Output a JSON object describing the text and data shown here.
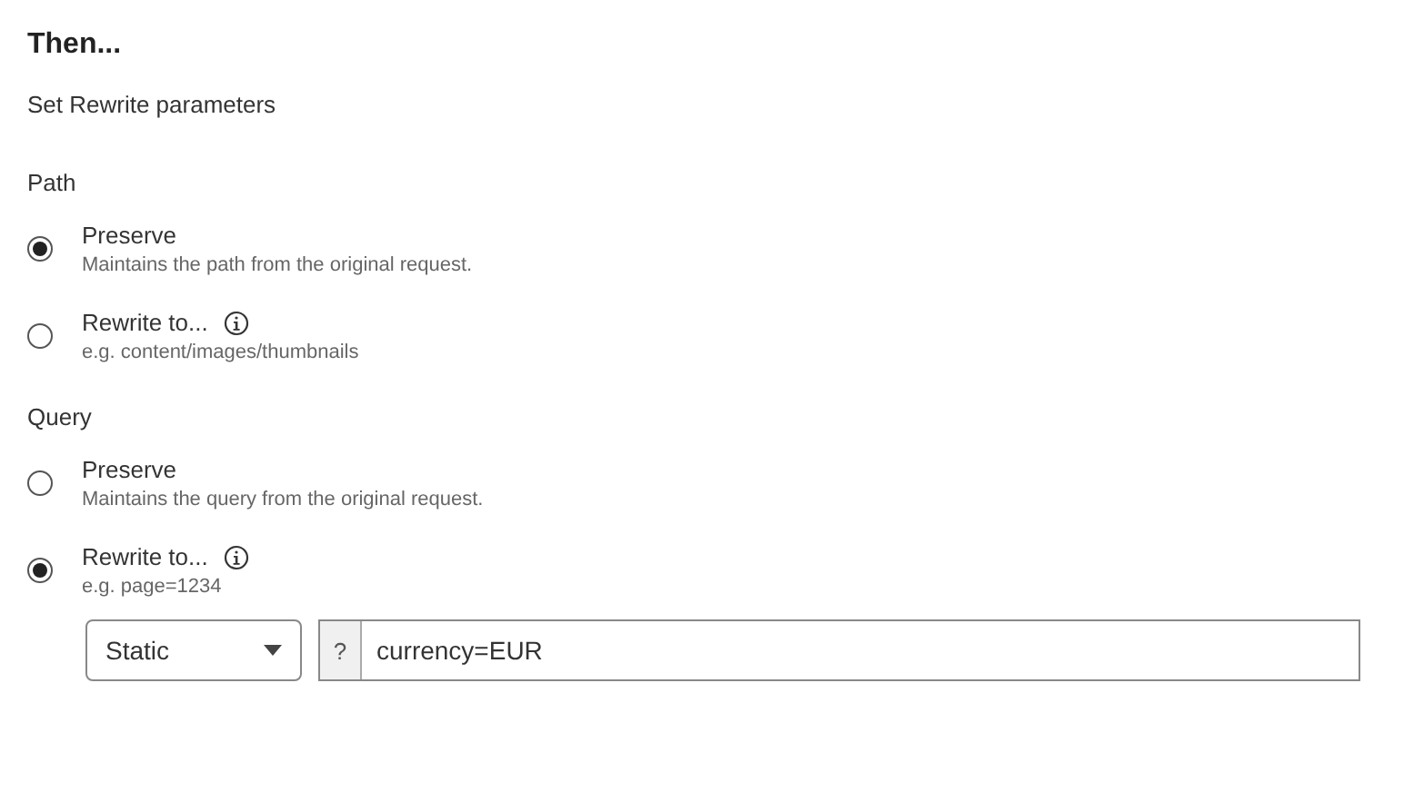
{
  "heading": "Then...",
  "subtitle": "Set Rewrite parameters",
  "groups": [
    {
      "label": "Path",
      "options": [
        {
          "label": "Preserve",
          "description": "Maintains the path from the original request.",
          "selected": true,
          "info": false
        },
        {
          "label": "Rewrite to...",
          "description": "e.g. content/images/thumbnails",
          "selected": false,
          "info": true
        }
      ]
    },
    {
      "label": "Query",
      "options": [
        {
          "label": "Preserve",
          "description": "Maintains the query from the original request.",
          "selected": false,
          "info": false
        },
        {
          "label": "Rewrite to...",
          "description": "e.g. page=1234",
          "selected": true,
          "info": true
        }
      ],
      "controls": {
        "select": {
          "value": "Static"
        },
        "input": {
          "prefix": "?",
          "value": "currency=EUR"
        }
      }
    }
  ]
}
